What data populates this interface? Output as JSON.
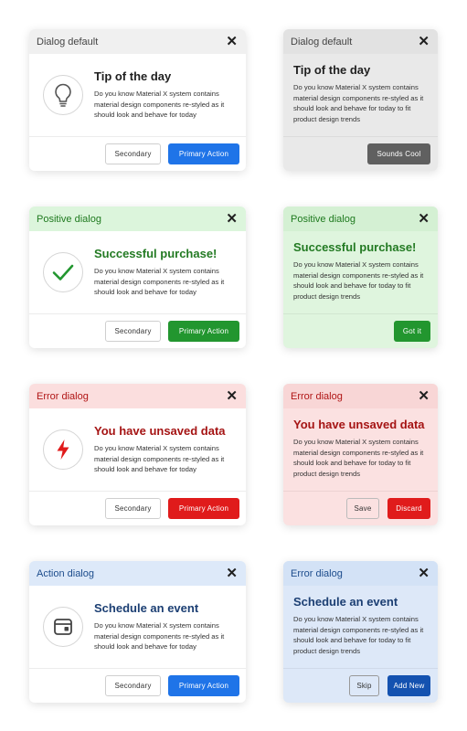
{
  "colors": {
    "primary_blue": "#1f74e8",
    "positive_green": "#22962f",
    "error_red": "#e01b1b",
    "neutral_dark": "#606060",
    "action_dark_blue": "#1452b0"
  },
  "dialogs": [
    {
      "theme": "default",
      "header": "Dialog default",
      "title": "Tip of the day",
      "description": "Do you know Material X system contains material design components re-styled as it should look and behave for today",
      "icon": "lightbulb-icon",
      "secondary_label": "Secondary",
      "primary_label": "Primary Action"
    },
    {
      "theme": "default",
      "header": "Dialog default",
      "title": "Tip of the day",
      "description": "Do you know Material X system contains material design components re-styled as it should look and behave for today to fit product design trends",
      "action_label": "Sounds Cool"
    },
    {
      "theme": "positive",
      "header": "Positive dialog",
      "title": "Successful purchase!",
      "description": "Do you know Material X system contains material design components re-styled as it should look and behave for today",
      "icon": "checkmark-icon",
      "secondary_label": "Secondary",
      "primary_label": "Primary Action"
    },
    {
      "theme": "positive",
      "header": "Positive dialog",
      "title": "Successful purchase!",
      "description": "Do you know Material X system contains material design components re-styled as it should look and behave for today to fit product design trends",
      "action_label": "Got it"
    },
    {
      "theme": "error",
      "header": "Error dialog",
      "title": "You have unsaved data",
      "description": "Do you know Material X system contains material design components re-styled as it should look and behave for today",
      "icon": "lightning-icon",
      "secondary_label": "Secondary",
      "primary_label": "Primary Action"
    },
    {
      "theme": "error",
      "header": "Error dialog",
      "title": "You have unsaved data",
      "description": "Do you know Material X system contains material design components re-styled as it should look and behave for today to fit product design trends",
      "secondary_label": "Save",
      "action_label": "Discard"
    },
    {
      "theme": "action",
      "header": "Action dialog",
      "title": "Schedule an event",
      "description": "Do you know Material X system contains material design components re-styled as it should look and behave for today",
      "icon": "calendar-icon",
      "secondary_label": "Secondary",
      "primary_label": "Primary Action"
    },
    {
      "theme": "action",
      "header": "Error dialog",
      "title": "Schedule an event",
      "description": "Do you know Material X system contains material design components re-styled as it should look and behave for today to fit product design trends",
      "secondary_label": "Skip",
      "action_label": "Add New"
    }
  ]
}
